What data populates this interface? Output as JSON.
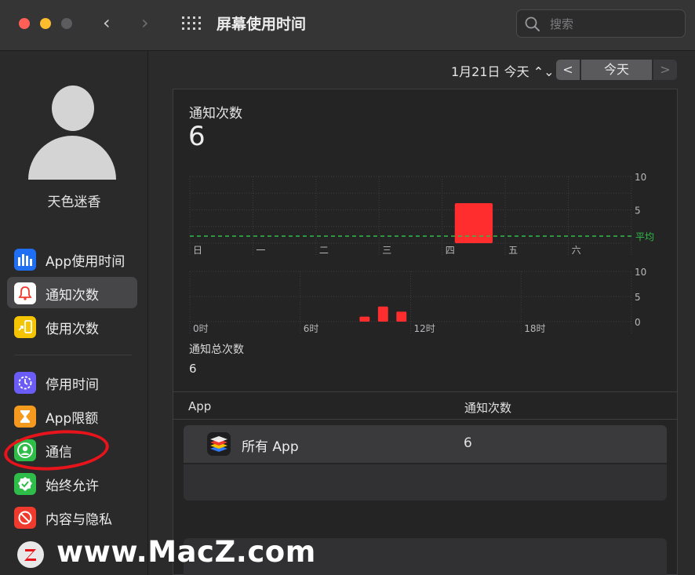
{
  "window": {
    "title": "屏幕使用时间",
    "search_placeholder": "搜索"
  },
  "sidebar": {
    "user_name": "天色迷香",
    "group1": [
      {
        "label": "App使用时间",
        "icon": "bar-chart-icon",
        "color": "#1f6ff5"
      },
      {
        "label": "通知次数",
        "icon": "bell-icon",
        "color": "#ffffff",
        "selected": true
      },
      {
        "label": "使用次数",
        "icon": "pickup-phone-icon",
        "color": "#f5c400"
      }
    ],
    "group2": [
      {
        "label": "停用时间",
        "icon": "downtime-icon",
        "color": "#6a5cf5"
      },
      {
        "label": "App限额",
        "icon": "hourglass-icon",
        "color": "#f59a1f"
      },
      {
        "label": "通信",
        "icon": "contact-icon",
        "color": "#2fbd4a"
      },
      {
        "label": "始终允许",
        "icon": "checkmark-shield-icon",
        "color": "#2fbd4a"
      },
      {
        "label": "内容与隐私",
        "icon": "restricted-icon",
        "color": "#f03a2e"
      }
    ]
  },
  "datebar": {
    "date_label": "1月21日 今天 ⌃⌄",
    "prev": "<",
    "today": "今天",
    "next": ">"
  },
  "summary": {
    "title": "通知次数",
    "count": "6",
    "total_label": "通知总次数",
    "total_value": "6"
  },
  "chart_data": [
    {
      "type": "bar",
      "categories": [
        "日",
        "一",
        "二",
        "三",
        "四",
        "五",
        "六"
      ],
      "values": [
        0,
        0,
        0,
        0,
        6,
        0,
        0
      ],
      "ylim": [
        0,
        10
      ],
      "yticks": [
        "10",
        "5"
      ],
      "average_label": "平均",
      "average": 0,
      "bar_color": "#ff2d2d",
      "average_color": "#2fbd4a"
    },
    {
      "type": "bar",
      "x_ticks": [
        "0时",
        "6时",
        "12时",
        "18时"
      ],
      "hours": [
        9,
        10,
        11
      ],
      "values": [
        1,
        3,
        2
      ],
      "ylim": [
        0,
        10
      ],
      "yticks": [
        "10",
        "5",
        "0"
      ],
      "bar_color": "#ff2d2d"
    }
  ],
  "table": {
    "col_app": "App",
    "col_count": "通知次数",
    "rows": [
      {
        "name": "所有 App",
        "count": "6"
      }
    ]
  },
  "watermark": {
    "text": "www.MacZ.com",
    "logo": "Z"
  }
}
